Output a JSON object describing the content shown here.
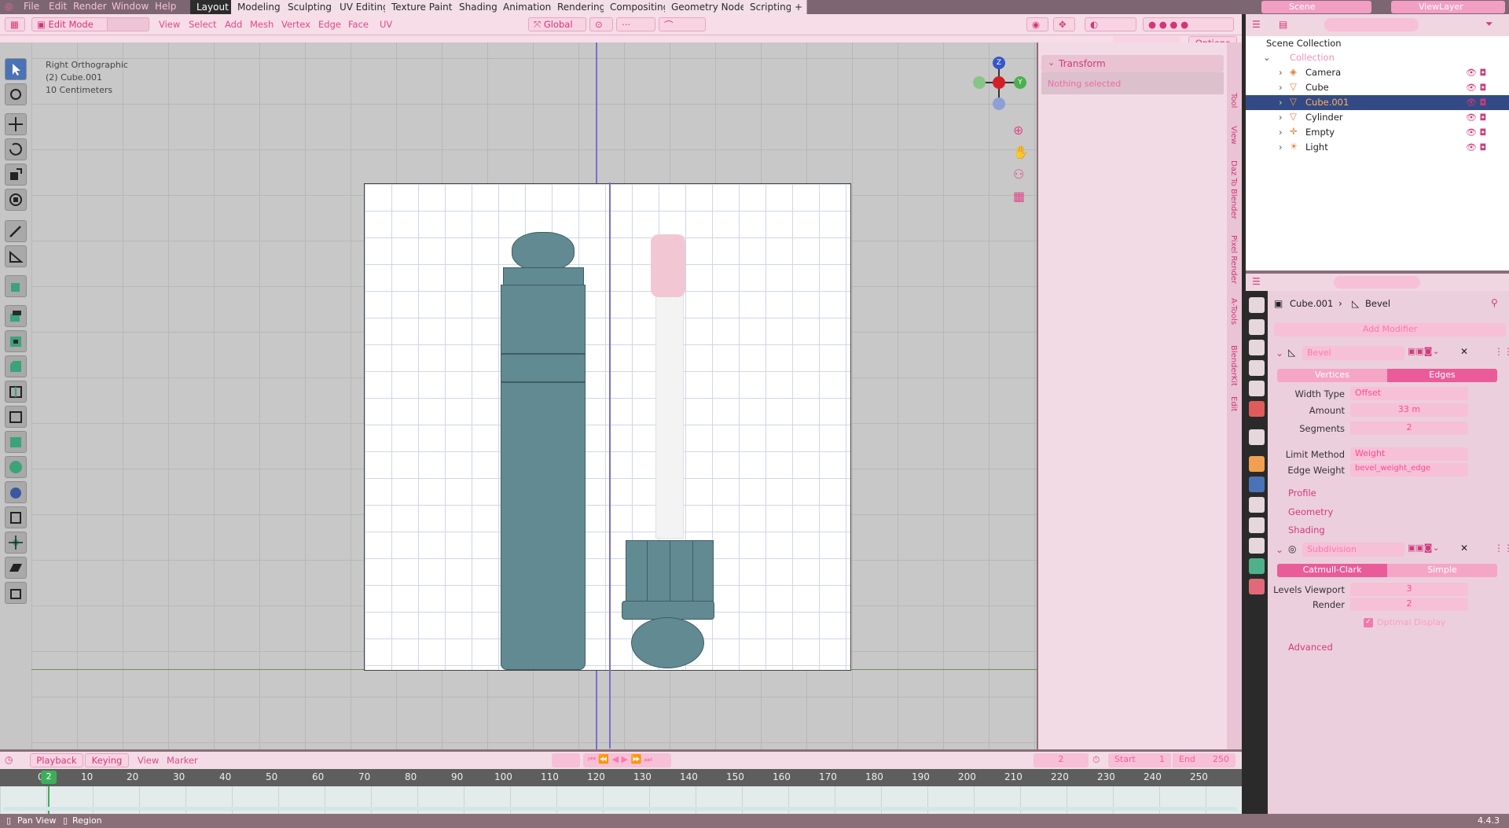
{
  "menu": [
    "File",
    "Edit",
    "Render",
    "Window",
    "Help"
  ],
  "workspaces": [
    "Layout",
    "Modeling",
    "Sculpting",
    "UV Editing",
    "Texture Paint",
    "Shading",
    "Animation",
    "Rendering",
    "Compositing",
    "Geometry Nodes",
    "Scripting"
  ],
  "workspace_add": "+",
  "viewport_header": {
    "mode": "Edit Mode",
    "menus": [
      "View",
      "Select",
      "Add",
      "Mesh",
      "Vertex",
      "Edge",
      "Face",
      "UV"
    ],
    "orientation": "Global",
    "options": "Options"
  },
  "viewport_info": {
    "view": "Right Orthographic",
    "object": "(2) Cube.001",
    "scale": "10 Centimeters"
  },
  "gizmo": {
    "z": "Z",
    "y": "Y"
  },
  "npanel": {
    "title": "Transform",
    "empty": "Nothing selected"
  },
  "side_tabs": [
    "Tool",
    "View",
    "Daz To Blender",
    "Pixel Render",
    "A-Tools",
    "BlenderKit",
    "Edit"
  ],
  "outliner": {
    "scene": "Scene",
    "view_layer": "ViewLayer",
    "title": "Scene Collection",
    "collection": "Collection",
    "items": [
      {
        "name": "Camera"
      },
      {
        "name": "Cube"
      },
      {
        "name": "Cube.001"
      },
      {
        "name": "Cylinder"
      },
      {
        "name": "Empty"
      },
      {
        "name": "Light"
      }
    ]
  },
  "properties": {
    "breadcrumb_object": "Cube.001",
    "breadcrumb_modifier": "Bevel",
    "add_modifier": "Add Modifier",
    "bevel": {
      "name": "Bevel",
      "tab_vertices": "Vertices",
      "tab_edges": "Edges",
      "width_type_label": "Width Type",
      "width_type": "Offset",
      "amount_label": "Amount",
      "amount": "33 m",
      "segments_label": "Segments",
      "segments": "2",
      "limit_label": "Limit Method",
      "limit": "Weight",
      "edge_weight_label": "Edge Weight",
      "edge_weight": "bevel_weight_edge",
      "profile": "Profile",
      "geometry": "Geometry",
      "shading": "Shading"
    },
    "subdiv": {
      "name": "Subdivision",
      "tab_cc": "Catmull-Clark",
      "tab_simple": "Simple",
      "levels_label": "Levels Viewport",
      "levels": "3",
      "render_label": "Render",
      "render": "2",
      "optimal": "Optimal Display",
      "advanced": "Advanced"
    }
  },
  "timeline": {
    "playback": "Playback",
    "keying": "Keying",
    "view": "View",
    "marker": "Marker",
    "current": "2",
    "start_label": "Start",
    "start": "1",
    "end_label": "End",
    "end": "250",
    "ruler": [
      "0",
      "10",
      "20",
      "30",
      "40",
      "50",
      "60",
      "70",
      "80",
      "90",
      "100",
      "110",
      "120",
      "130",
      "140",
      "150",
      "160",
      "170",
      "180",
      "190",
      "200",
      "210",
      "220",
      "230",
      "240",
      "250"
    ],
    "marker_frame": "2"
  },
  "status": {
    "pan": "Pan View",
    "region": "Region",
    "version": "4.4.3"
  },
  "colors": {
    "accent": "#e0488a",
    "selection": "#334a84",
    "viewport": "#c8c8c8"
  }
}
